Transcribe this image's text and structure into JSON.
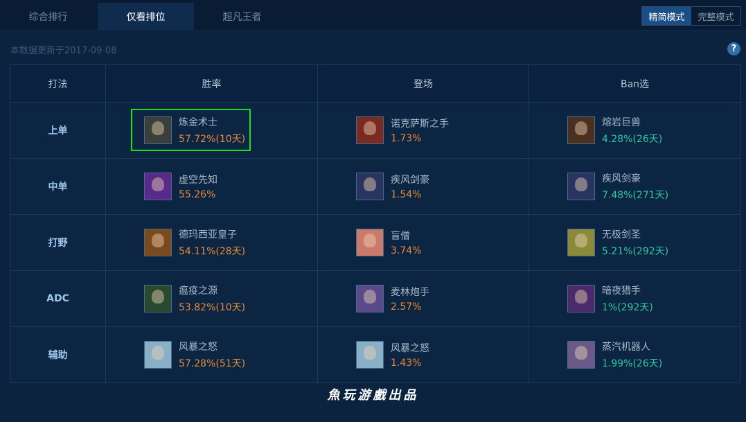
{
  "tabs": [
    "综合排行",
    "仅看排位",
    "超凡王者"
  ],
  "active_tab": 1,
  "modes": [
    "精简模式",
    "完整模式"
  ],
  "active_mode": 0,
  "update_text": "本数据更新于2017-09-08",
  "help_label": "?",
  "table": {
    "headers": [
      "打法",
      "胜率",
      "登场",
      "Ban选"
    ],
    "rows": [
      {
        "lane": "上单",
        "win": {
          "name": "炼金术士",
          "stat": "57.72%(10天)",
          "avatar_color": "#3a3f3a"
        },
        "pick": {
          "name": "诺克萨斯之手",
          "stat": "1.73%",
          "avatar_color": "#7a2a20"
        },
        "ban": {
          "name": "熔岩巨兽",
          "stat": "4.28%(26天)",
          "avatar_color": "#4a3020"
        }
      },
      {
        "lane": "中单",
        "win": {
          "name": "虚空先知",
          "stat": "55.26%",
          "avatar_color": "#5a2a8a"
        },
        "pick": {
          "name": "疾风剑豪",
          "stat": "1.54%",
          "avatar_color": "#2a3460"
        },
        "ban": {
          "name": "疾风剑豪",
          "stat": "7.48%(271天)",
          "avatar_color": "#2a3460"
        }
      },
      {
        "lane": "打野",
        "win": {
          "name": "德玛西亚皇子",
          "stat": "54.11%(28天)",
          "avatar_color": "#7a4a1c"
        },
        "pick": {
          "name": "盲僧",
          "stat": "3.74%",
          "avatar_color": "#c97a6a"
        },
        "ban": {
          "name": "无极剑圣",
          "stat": "5.21%(292天)",
          "avatar_color": "#8a8a3a"
        }
      },
      {
        "lane": "ADC",
        "win": {
          "name": "瘟疫之源",
          "stat": "53.82%(10天)",
          "avatar_color": "#2a4a30"
        },
        "pick": {
          "name": "麦林炮手",
          "stat": "2.57%",
          "avatar_color": "#5a4a8a"
        },
        "ban": {
          "name": "暗夜猎手",
          "stat": "1%(292天)",
          "avatar_color": "#4a2a6a"
        }
      },
      {
        "lane": "辅助",
        "win": {
          "name": "风暴之怒",
          "stat": "57.28%(51天)",
          "avatar_color": "#8ab0c8"
        },
        "pick": {
          "name": "风暴之怒",
          "stat": "1.43%",
          "avatar_color": "#8ab0c8"
        },
        "ban": {
          "name": "蒸汽机器人",
          "stat": "1.99%(26天)",
          "avatar_color": "#6a5a8a"
        }
      }
    ]
  },
  "colors": {
    "win_stat": "#e58a36",
    "pick_stat": "#e58a36",
    "ban_stat": "#2fc7a2",
    "highlight": "#19e01c"
  },
  "watermark": "魚玩游戲出品"
}
